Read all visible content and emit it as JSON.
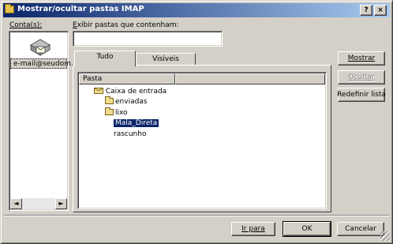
{
  "window": {
    "title": "Mostrar/ocultar pastas IMAP",
    "help_btn": "?",
    "close_btn": "×"
  },
  "accounts": {
    "label": "Conta(s):",
    "items": [
      {
        "name": "e-mail@seudom..."
      }
    ],
    "scroll_left": "◄",
    "scroll_right": "►"
  },
  "filter": {
    "label": "Exibir pastas que contenham:",
    "value": ""
  },
  "tabs": [
    {
      "label": "Tudo"
    },
    {
      "label": "Visíveis"
    }
  ],
  "folder_list": {
    "column": "Pasta",
    "rows": [
      {
        "label": "Caixa de entrada"
      },
      {
        "label": "enviadas"
      },
      {
        "label": "lixo"
      },
      {
        "label": "Mala_Direta"
      },
      {
        "label": "rascunho"
      }
    ]
  },
  "side_buttons": {
    "show": "Mostrar",
    "hide": "Ocultar",
    "reset": "Redefinir lista"
  },
  "footer": {
    "goto": "Ir para",
    "ok": "OK",
    "cancel": "Cancelar"
  }
}
